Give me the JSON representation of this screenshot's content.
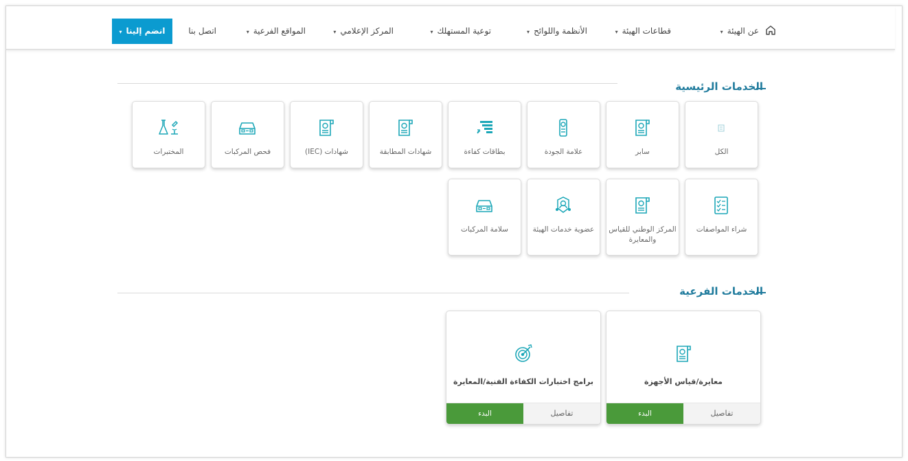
{
  "nav": {
    "items": [
      {
        "label": "عن الهيئة",
        "dropdown": true
      },
      {
        "label": "قطاعات الهيئة",
        "dropdown": true
      },
      {
        "label": "الأنظمة واللوائح",
        "dropdown": true
      },
      {
        "label": "توعية المستهلك",
        "dropdown": true
      },
      {
        "label": "المركز الإعلامي",
        "dropdown": true
      },
      {
        "label": "المواقع الفرعية",
        "dropdown": true
      },
      {
        "label": "اتصل بنا",
        "dropdown": false
      }
    ],
    "join": "انضم إلينا",
    "home_icon": "home-icon",
    "caret": "▾"
  },
  "main_services": {
    "title": "الخدمات الرئيسية",
    "items": [
      {
        "label": "الكل",
        "icon": "grid-icon"
      },
      {
        "label": "سابر",
        "icon": "certificate-scroll-icon"
      },
      {
        "label": "علامة الجودة",
        "icon": "quality-mark-icon"
      },
      {
        "label": "بطاقات كفاءة",
        "icon": "efficiency-card-icon"
      },
      {
        "label": "شهادات المطابقة",
        "icon": "certificate-scroll-icon"
      },
      {
        "label": "شهادات (IEC)",
        "icon": "certificate-scroll-icon"
      },
      {
        "label": "فحص المركبات",
        "icon": "car-icon"
      },
      {
        "label": "المختبرات",
        "icon": "lab-icon"
      },
      {
        "label": "شراء المواصفات",
        "icon": "checklist-icon"
      },
      {
        "label": "المركز الوطني للقياس والمعايرة",
        "icon": "certificate-scroll-icon"
      },
      {
        "label": "عضوية خدمات الهيئة",
        "icon": "membership-icon"
      },
      {
        "label": "سلامة المركبات",
        "icon": "car-icon"
      }
    ]
  },
  "sub_services": {
    "title": "الخدمات الفرعية",
    "items": [
      {
        "title": "معايرة/قياس الأجهزة",
        "icon": "certificate-scroll-icon",
        "details": "تفاصيل",
        "start": "البدء"
      },
      {
        "title": "برامج اختبارات الكفاءة الفنية/المعايرة",
        "icon": "target-icon",
        "details": "تفاصيل",
        "start": "البدء"
      }
    ]
  },
  "colors": {
    "accent": "#0b9bd0",
    "title": "#1e7a9c",
    "icon": "#1aa6b7",
    "start": "#4a9a3a"
  }
}
